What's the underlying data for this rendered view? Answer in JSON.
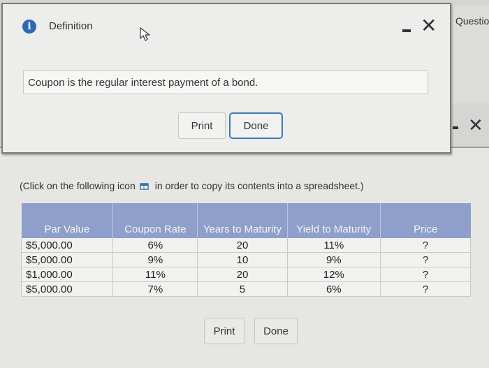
{
  "background_window": {
    "tab_label": "Questio"
  },
  "instruction": {
    "before_icon": "(Click on the following icon",
    "after_icon": "in order to copy its contents into a spreadsheet.)",
    "icon": "copy-icon"
  },
  "table": {
    "headers": [
      "Par Value",
      "Coupon Rate",
      "Years to Maturity",
      "Yield to Maturity",
      "Price"
    ],
    "rows": [
      [
        "$5,000.00",
        "6%",
        "20",
        "11%",
        "?"
      ],
      [
        "$5,000.00",
        "9%",
        "10",
        "9%",
        "?"
      ],
      [
        "$1,000.00",
        "11%",
        "20",
        "12%",
        "?"
      ],
      [
        "$5,000.00",
        "7%",
        "5",
        "6%",
        "?"
      ]
    ],
    "header_color": "#8e9fcb"
  },
  "background_buttons": {
    "print": "Print",
    "done": "Done"
  },
  "dialog": {
    "title": "Definition",
    "definition_text": "Coupon is the regular interest payment of a bond.",
    "print_label": "Print",
    "done_label": "Done",
    "minimize_icon": "minimize-icon",
    "close_icon": "close-icon",
    "accent_color": "#3c77bf",
    "info_color": "#2f67b5"
  }
}
